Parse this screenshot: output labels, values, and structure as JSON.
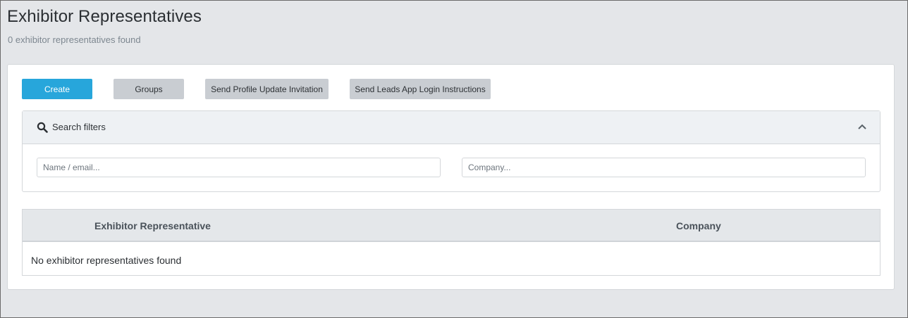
{
  "page": {
    "title": "Exhibitor Representatives",
    "subtitle": "0 exhibitor representatives found"
  },
  "toolbar": {
    "create_label": "Create",
    "groups_label": "Groups",
    "send_profile_label": "Send Profile Update Invitation",
    "send_leads_label": "Send Leads App Login Instructions"
  },
  "filters": {
    "title": "Search filters",
    "name_placeholder": "Name / email...",
    "company_placeholder": "Company..."
  },
  "table": {
    "columns": [
      "Exhibitor Representative",
      "Company"
    ],
    "empty_message": "No exhibitor representatives found"
  },
  "colors": {
    "primary": "#27a6db",
    "secondary": "#c9cdd2",
    "background": "#e4e6e9"
  },
  "icons": {
    "search": "search-icon",
    "collapse": "chevron-up-icon"
  }
}
